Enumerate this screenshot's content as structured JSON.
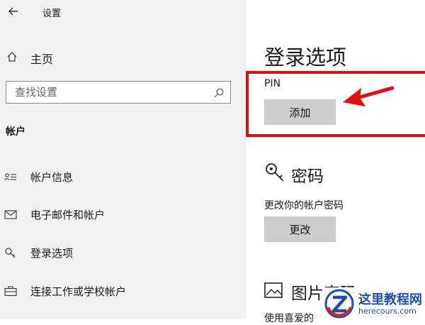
{
  "window": {
    "title": "设置"
  },
  "sidebar": {
    "home_label": "主页",
    "search_placeholder": "查找设置",
    "section_header": "帐户",
    "items": [
      {
        "label": "帐户信息",
        "icon": "account-info-icon"
      },
      {
        "label": "电子邮件和帐户",
        "icon": "mail-icon"
      },
      {
        "label": "登录选项",
        "icon": "key-icon"
      },
      {
        "label": "连接工作或学校帐户",
        "icon": "briefcase-icon"
      }
    ]
  },
  "main": {
    "title": "登录选项",
    "pin": {
      "label": "PIN",
      "button": "添加"
    },
    "password": {
      "title": "密码",
      "description": "更改你的帐户密码",
      "button": "更改",
      "icon": "key-icon"
    },
    "picture_password": {
      "title": "图片密码",
      "description": "使用喜爱的",
      "icon": "picture-icon"
    }
  },
  "annotation": {
    "highlight_color": "#e01010"
  },
  "watermark": {
    "name": "这里教程网",
    "url": "herecours.com"
  },
  "colors": {
    "sidebar_bg": "#f2f2f2",
    "button_bg": "#cccccc",
    "watermark": "#1f4fa8"
  }
}
